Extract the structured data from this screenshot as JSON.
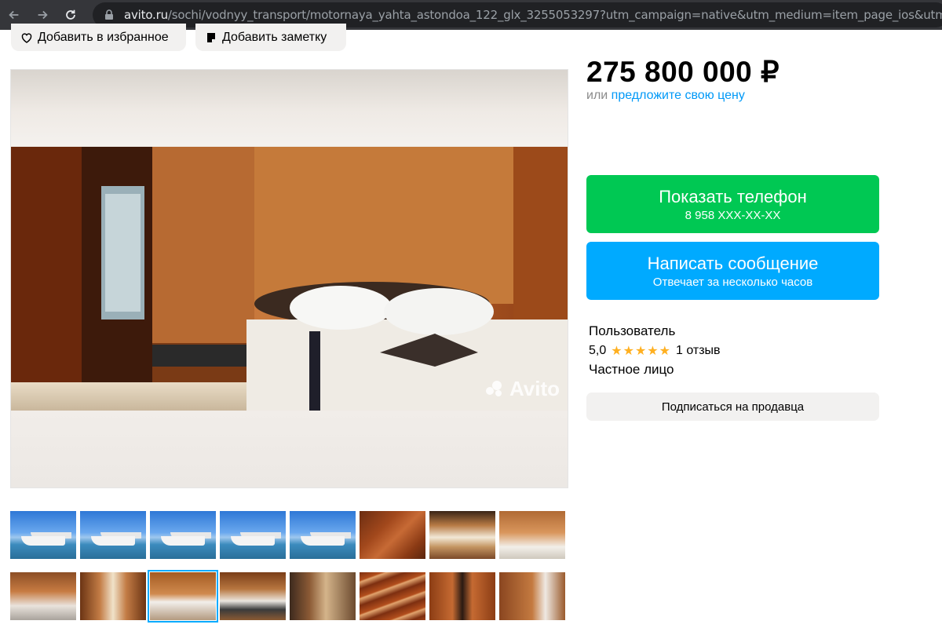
{
  "browser": {
    "url_host": "avito.ru",
    "url_path": "/sochi/vodnyy_transport/motornaya_yahta_astondoa_122_glx_3255053297?utm_campaign=native&utm_medium=item_page_ios&utm_sourc…"
  },
  "actions": {
    "favorite_label": "Добавить в избранное",
    "note_label": "Добавить заметку"
  },
  "listing": {
    "price": "275 800 000 ₽",
    "offer_prefix": "или",
    "offer_link": "предложите свою цену",
    "watermark": "Avito"
  },
  "contact": {
    "phone_label": "Показать телефон",
    "phone_masked": "8 958 XXX-XX-XX",
    "message_label": "Написать сообщение",
    "message_sub": "Отвечает за несколько часов"
  },
  "seller": {
    "name": "Пользователь",
    "rating": "5,0",
    "stars": "★★★★★",
    "reviews": "1 отзыв",
    "type": "Частное лицо",
    "subscribe_label": "Подписаться на продавца"
  },
  "thumbnails": [
    {
      "kind": "yacht"
    },
    {
      "kind": "yacht"
    },
    {
      "kind": "yacht"
    },
    {
      "kind": "yacht"
    },
    {
      "kind": "yacht"
    },
    {
      "kind": "wood"
    },
    {
      "kind": "dining"
    },
    {
      "kind": "panel"
    },
    {
      "kind": "kitchen"
    },
    {
      "kind": "corridor"
    },
    {
      "kind": "bed",
      "selected": true
    },
    {
      "kind": "sofa"
    },
    {
      "kind": "bath"
    },
    {
      "kind": "stairs"
    },
    {
      "kind": "door"
    },
    {
      "kind": "wc"
    }
  ],
  "colors": {
    "phone_button": "#00c853",
    "message_button": "#00aaff",
    "link": "#0099f7",
    "stars": "#ffb021"
  }
}
